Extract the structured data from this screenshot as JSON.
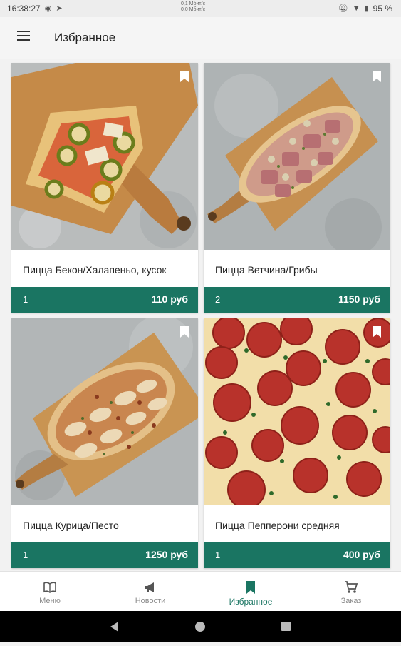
{
  "status_bar": {
    "time": "16:38:27",
    "net_speed_up": "0,1 Мбит/с",
    "net_speed_down": "0,0 Мбит/с",
    "battery": "95 %"
  },
  "app_bar": {
    "title": "Избранное"
  },
  "cards": [
    {
      "name": "Пицца Бекон/Халапеньо, кусок",
      "qty": "1",
      "price": "110 руб",
      "image": "pizza-slice-bacon-jalapeno"
    },
    {
      "name": "Пицца Ветчина/Грибы",
      "qty": "2",
      "price": "1150 руб",
      "image": "pizza-ham-mushroom"
    },
    {
      "name": "Пицца Курица/Песто",
      "qty": "1",
      "price": "1250 руб",
      "image": "pizza-chicken-pesto"
    },
    {
      "name": "Пицца Пепперони средняя",
      "qty": "1",
      "price": "400 руб",
      "image": "pizza-pepperoni"
    }
  ],
  "bottom_nav": [
    {
      "label": "Меню",
      "icon": "book-icon",
      "active": false
    },
    {
      "label": "Новости",
      "icon": "megaphone-icon",
      "active": false
    },
    {
      "label": "Избранное",
      "icon": "bookmark-icon",
      "active": true
    },
    {
      "label": "Заказ",
      "icon": "cart-icon",
      "active": false
    }
  ],
  "colors": {
    "accent": "#1a7562",
    "background": "#f2f2f2"
  }
}
